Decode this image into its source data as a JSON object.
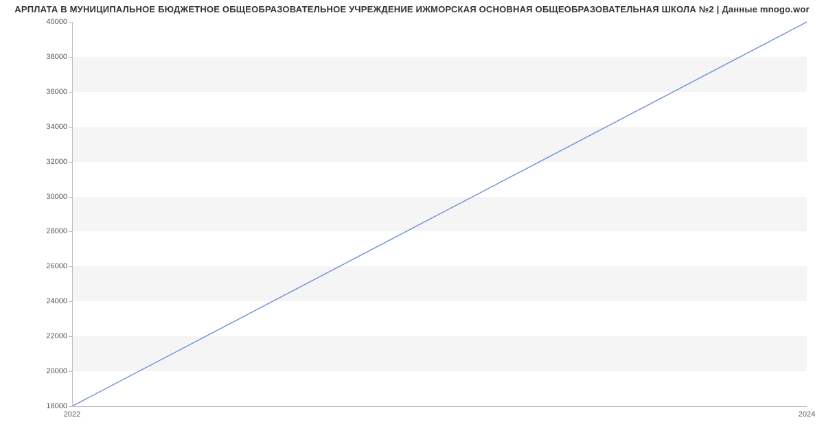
{
  "chart_data": {
    "type": "line",
    "title": "АРПЛАТА В МУНИЦИПАЛЬНОЕ БЮДЖЕТНОЕ ОБЩЕОБРАЗОВАТЕЛЬНОЕ УЧРЕЖДЕНИЕ ИЖМОРСКАЯ ОСНОВНАЯ ОБЩЕОБРАЗОВАТЕЛЬНАЯ ШКОЛА №2 | Данные mnogo.wor",
    "x": [
      2022,
      2024
    ],
    "values": [
      18000,
      40000
    ],
    "x_ticks": [
      2022,
      2024
    ],
    "y_ticks": [
      18000,
      20000,
      22000,
      24000,
      26000,
      28000,
      30000,
      32000,
      34000,
      36000,
      38000,
      40000
    ],
    "xlim": [
      2022,
      2024
    ],
    "ylim": [
      18000,
      40000
    ],
    "line_color": "#6f8fd9",
    "band_color": "#f5f5f5",
    "grid": "horizontal-bands"
  }
}
